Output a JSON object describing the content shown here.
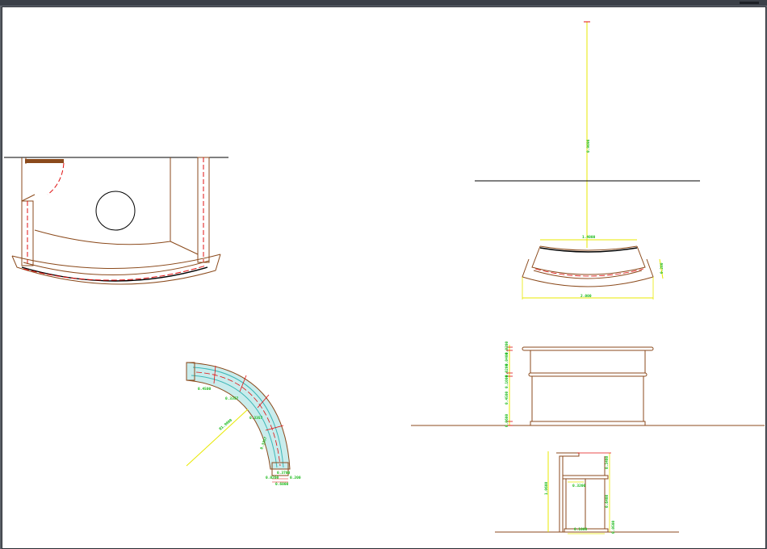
{
  "drawing": {
    "dimensions": {
      "elevation_height": "0.9696",
      "top_width": "1.4000",
      "overall_width": "2.000",
      "side_depth": "0.200",
      "curve_radius": "R1.9000",
      "curve_seg_a": "0.4500",
      "curve_seg_b": "0.3357",
      "curve_seg_c": "0.3357",
      "curve_seg_d": "0.3357",
      "end_w1": "0.3700",
      "end_w2": "0.200",
      "end_w3": "0.0200",
      "end_w4": "0.6000",
      "front_d1": "0.0200",
      "front_d2": "0.0400",
      "front_d3": "0.0200",
      "front_d4": "0.1000",
      "front_d5": "0.4500",
      "front_d6": "0.0600",
      "side_height": "1.0600",
      "side_top": "0.3400",
      "side_inner": "0.3200",
      "side_mid": "0.6400",
      "side_base": "0.0500",
      "side_base_w": "0.1000"
    },
    "colors": {
      "background": "#ffffff",
      "outline": "#8b4a1c",
      "dimension_line": "#e8e800",
      "dimension_text": "#14b814",
      "center_line": "#e01010",
      "cyan_hatch": "#3fb7b7",
      "ground_line": "#000000",
      "window_frame": "#3b4048"
    }
  }
}
